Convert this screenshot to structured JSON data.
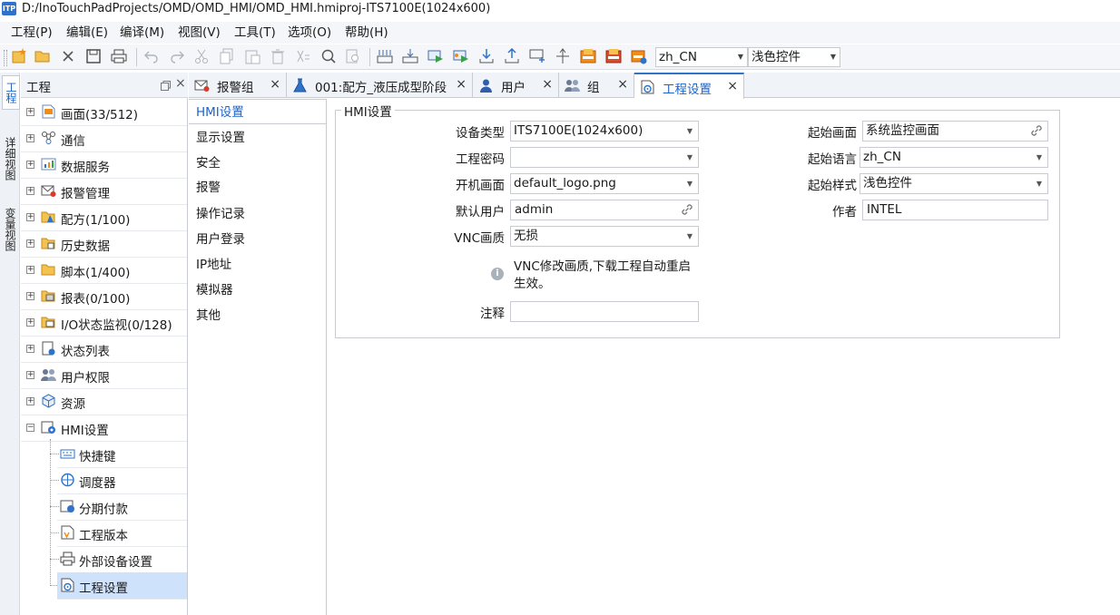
{
  "window": {
    "title": "D:/InoTouchPadProjects/OMD/OMD_HMI/OMD_HMI.hmiproj-ITS7100E(1024x600)",
    "app_icon_text": "ITP"
  },
  "menu": {
    "items": [
      "工程(P)",
      "编辑(E)",
      "编译(M)",
      "视图(V)",
      "工具(T)",
      "选项(O)",
      "帮助(H)"
    ]
  },
  "toolbar": {
    "language_select": "zh_CN",
    "style_select": "浅色控件"
  },
  "side_strip": {
    "tabs": [
      "工程",
      "详细视图",
      "变量视图"
    ]
  },
  "project_panel": {
    "title": "工程",
    "tree": [
      {
        "label": "画面(33/512)",
        "icon": "screen-icon",
        "expander": "+"
      },
      {
        "label": "通信",
        "icon": "network-icon",
        "expander": "+"
      },
      {
        "label": "数据服务",
        "icon": "chart-icon",
        "expander": "+"
      },
      {
        "label": "报警管理",
        "icon": "alarm-mail-icon",
        "expander": "+"
      },
      {
        "label": "配方(1/100)",
        "icon": "recipe-folder-icon",
        "expander": "+"
      },
      {
        "label": "历史数据",
        "icon": "history-folder-icon",
        "expander": "+"
      },
      {
        "label": "脚本(1/400)",
        "icon": "script-folder-icon",
        "expander": "+"
      },
      {
        "label": "报表(0/100)",
        "icon": "report-folder-icon",
        "expander": "+"
      },
      {
        "label": "I/O状态监视(0/128)",
        "icon": "io-folder-icon",
        "expander": "+"
      },
      {
        "label": "状态列表",
        "icon": "status-list-icon",
        "expander": "+"
      },
      {
        "label": "用户权限",
        "icon": "users-icon",
        "expander": "+"
      },
      {
        "label": "资源",
        "icon": "resource-icon",
        "expander": "+"
      },
      {
        "label": "HMI设置",
        "icon": "hmi-settings-icon",
        "expander": "−"
      }
    ],
    "sub_items": [
      {
        "label": "快捷键",
        "icon": "keyboard-icon"
      },
      {
        "label": "调度器",
        "icon": "scheduler-icon"
      },
      {
        "label": "分期付款",
        "icon": "installment-icon"
      },
      {
        "label": "工程版本",
        "icon": "version-icon"
      },
      {
        "label": "外部设备设置",
        "icon": "printer-icon"
      },
      {
        "label": "工程设置",
        "icon": "project-settings-icon"
      }
    ]
  },
  "tabs": [
    {
      "label": "报警组",
      "icon": "alarm-tab-icon"
    },
    {
      "label": "001:配方_液压成型阶段",
      "icon": "flask-icon"
    },
    {
      "label": "用户",
      "icon": "user-icon"
    },
    {
      "label": "组",
      "icon": "group-icon"
    },
    {
      "label": "工程设置",
      "icon": "project-settings-icon",
      "active": true
    }
  ],
  "settings_nav": [
    "HMI设置",
    "显示设置",
    "安全",
    "报警",
    "操作记录",
    "用户登录",
    "IP地址",
    "模拟器",
    "其他"
  ],
  "form": {
    "group_title": "HMI设置",
    "device_type_label": "设备类型",
    "device_type_value": "ITS7100E(1024x600)",
    "password_label": "工程密码",
    "password_value": "",
    "boot_screen_label": "开机画面",
    "boot_screen_value": "default_logo.png",
    "default_user_label": "默认用户",
    "default_user_value": "admin",
    "vnc_label": "VNC画质",
    "vnc_value": "无损",
    "vnc_note": "VNC修改画质,下载工程自动重启\n生效。",
    "comment_label": "注释",
    "comment_value": "",
    "start_screen_label": "起始画面",
    "start_screen_value": "系统监控画面",
    "start_lang_label": "起始语言",
    "start_lang_value": "zh_CN",
    "start_style_label": "起始样式",
    "start_style_value": "浅色控件",
    "author_label": "作者",
    "author_value": "INTEL"
  },
  "colors": {
    "accent": "#2e73c9",
    "selected_row": "#cfe2fb",
    "border": "#c8ccd2"
  }
}
